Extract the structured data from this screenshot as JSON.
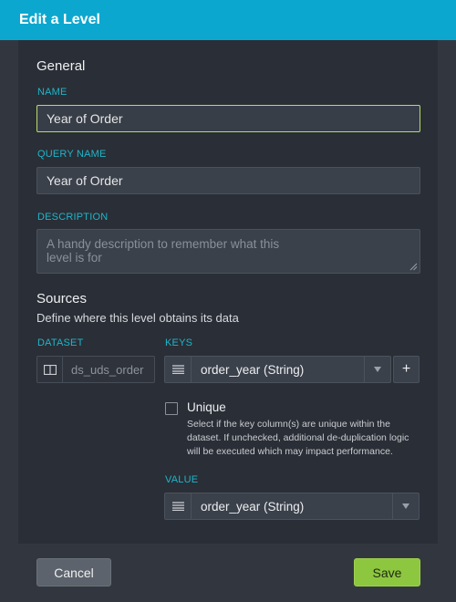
{
  "dialog": {
    "title": "Edit a Level"
  },
  "general": {
    "heading": "General",
    "name": {
      "label": "NAME",
      "value": "Year of Order"
    },
    "query_name": {
      "label": "QUERY NAME",
      "value": "Year of Order"
    },
    "description": {
      "label": "DESCRIPTION",
      "placeholder": "A handy description to remember what this level is for"
    }
  },
  "sources": {
    "heading": "Sources",
    "subtitle": "Define where this level obtains its data",
    "dataset": {
      "label": "DATASET",
      "value": "ds_uds_order"
    },
    "keys": {
      "label": "KEYS",
      "value": "order_year (String)",
      "add_label": "+"
    },
    "unique": {
      "label": "Unique",
      "checked": false,
      "help_lines": [
        "Select if the key column(s) are unique within the",
        "dataset. If unchecked, additional de-duplication logic",
        "will be executed which may impact performance."
      ]
    },
    "value": {
      "label": "VALUE",
      "value": "order_year (String)"
    }
  },
  "footer": {
    "cancel_label": "Cancel",
    "save_label": "Save"
  },
  "colors": {
    "accent": "#0ca7cf",
    "label": "#1fb5c9",
    "save": "#8dc63f",
    "focus": "#b8d96b"
  }
}
